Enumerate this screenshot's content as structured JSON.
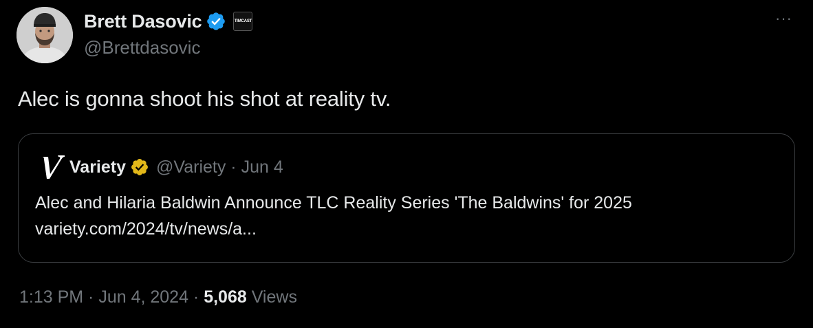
{
  "author": {
    "display_name": "Brett Dasovic",
    "handle": "@Brettdasovic",
    "verified_color": "#1d9bf0",
    "affiliation_badge": "TIMCAST"
  },
  "more_label": "···",
  "tweet_text": "Alec is gonna shoot his shot at reality tv.",
  "quote": {
    "display_name": "Variety",
    "meta": "@Variety · Jun 4",
    "verified_color": "#e2b719",
    "headline": "Alec and Hilaria Baldwin Announce TLC Reality Series 'The Baldwins' for 2025",
    "link": "variety.com/2024/tv/news/a..."
  },
  "footer": {
    "timestamp": "1:13 PM · Jun 4, 2024 · ",
    "views_count": "5,068",
    "views_label": " Views"
  },
  "icons": {
    "avatar": "avatar",
    "verified": "verified-badge-icon",
    "more": "more-icon",
    "variety_logo": "variety-logo"
  }
}
